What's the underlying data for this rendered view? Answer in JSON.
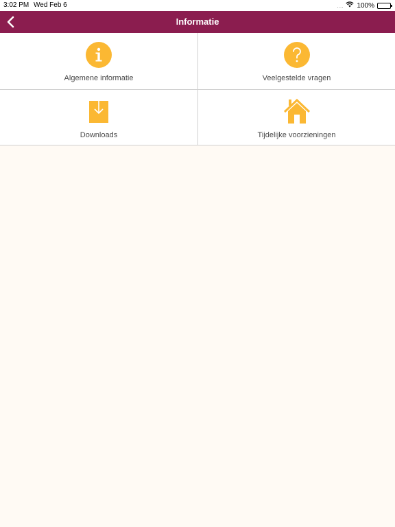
{
  "status_bar": {
    "time": "3:02 PM",
    "date": "Wed Feb 6",
    "signal": "....",
    "battery_percent": "100%"
  },
  "navbar": {
    "back_icon": "chevron-left-icon",
    "title": "Informatie",
    "color": "#8b1d4f"
  },
  "tiles": [
    {
      "label": "Algemene informatie",
      "icon": "info-icon"
    },
    {
      "label": "Veelgestelde vragen",
      "icon": "question-icon"
    },
    {
      "label": "Downloads",
      "icon": "download-icon"
    },
    {
      "label": "Tijdelijke voorzieningen",
      "icon": "house-icon"
    }
  ],
  "colors": {
    "accent": "#fbb833",
    "background": "#fffaf4"
  }
}
